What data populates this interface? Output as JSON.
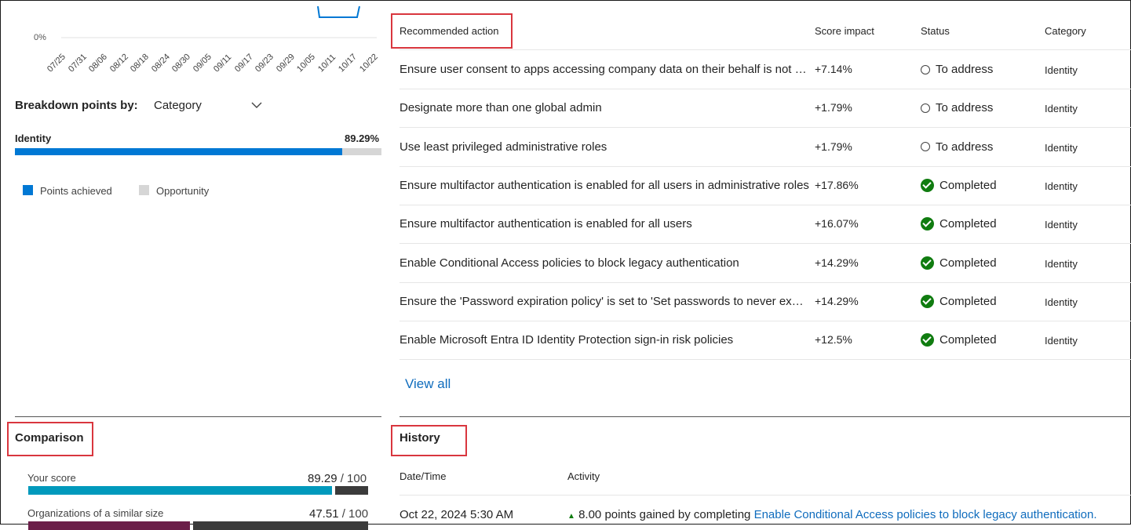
{
  "chart": {
    "y_label": "0%",
    "x_ticks": [
      "07/25",
      "07/31",
      "08/06",
      "08/12",
      "08/18",
      "08/24",
      "08/30",
      "09/05",
      "09/11",
      "09/17",
      "09/23",
      "09/29",
      "10/05",
      "10/11",
      "10/17",
      "10/22"
    ]
  },
  "breakdown": {
    "label": "Breakdown points by:",
    "selected": "Category",
    "item_name": "Identity",
    "item_percent": "89.29%",
    "item_fraction": 0.8929,
    "legend": {
      "achieved": "Points achieved",
      "opportunity": "Opportunity"
    },
    "colors": {
      "achieved": "#0078d4",
      "opportunity": "#d6d6d6"
    }
  },
  "recommended": {
    "headers": {
      "action": "Recommended action",
      "impact": "Score impact",
      "status": "Status",
      "category": "Category"
    },
    "rows": [
      {
        "action": "Ensure user consent to apps accessing company data on their behalf is not allowed",
        "impact": "+7.14%",
        "status": "To address",
        "status_icon": "empty-circle-icon",
        "category": "Identity"
      },
      {
        "action": "Designate more than one global admin",
        "impact": "+1.79%",
        "status": "To address",
        "status_icon": "empty-circle-icon",
        "category": "Identity"
      },
      {
        "action": "Use least privileged administrative roles",
        "impact": "+1.79%",
        "status": "To address",
        "status_icon": "empty-circle-icon",
        "category": "Identity"
      },
      {
        "action": "Ensure multifactor authentication is enabled for all users in administrative roles",
        "impact": "+17.86%",
        "status": "Completed",
        "status_icon": "check-circle-icon",
        "category": "Identity"
      },
      {
        "action": "Ensure multifactor authentication is enabled for all users",
        "impact": "+16.07%",
        "status": "Completed",
        "status_icon": "check-circle-icon",
        "category": "Identity"
      },
      {
        "action": "Enable Conditional Access policies to block legacy authentication",
        "impact": "+14.29%",
        "status": "Completed",
        "status_icon": "check-circle-icon",
        "category": "Identity"
      },
      {
        "action": "Ensure the 'Password expiration policy' is set to 'Set passwords to never expire'",
        "impact": "+14.29%",
        "status": "Completed",
        "status_icon": "check-circle-icon",
        "category": "Identity"
      },
      {
        "action": "Enable Microsoft Entra ID Identity Protection sign-in risk policies",
        "impact": "+12.5%",
        "status": "Completed",
        "status_icon": "check-circle-icon",
        "category": "Identity"
      }
    ],
    "view_all": "View all"
  },
  "comparison": {
    "title": "Comparison",
    "your_score_label": "Your score",
    "your_score_value": "89.29",
    "your_score_max": "/ 100",
    "your_score_fraction": 0.8929,
    "similar_label": "Organizations of a similar size",
    "similar_value": "47.51",
    "similar_max": "/ 100",
    "similar_fraction": 0.4751,
    "colors": {
      "your_bar": "#0099bc",
      "similar_bar": "#6b1e49",
      "remainder": "#3b3b3b"
    }
  },
  "history": {
    "title": "History",
    "headers": {
      "datetime": "Date/Time",
      "activity": "Activity"
    },
    "rows": [
      {
        "datetime": "Oct 22, 2024 5:30 AM",
        "activity_prefix": "8.00 points gained by completing",
        "activity_link": "Enable Conditional Access policies to block legacy authentication."
      }
    ]
  }
}
